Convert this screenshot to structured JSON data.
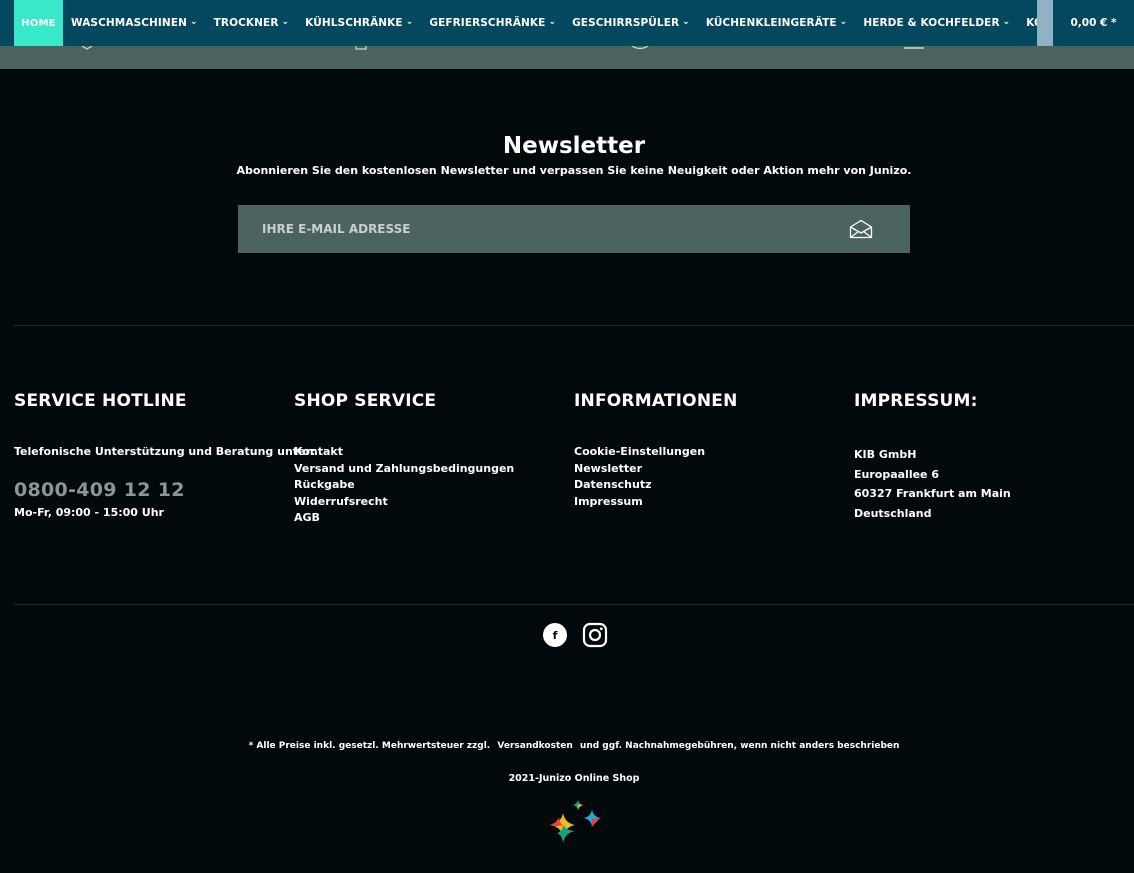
{
  "nav": {
    "home_label": "HOME",
    "items": [
      {
        "label": "WASCHMASCHINEN"
      },
      {
        "label": "TROCKNER"
      },
      {
        "label": "KÜHLSCHRÄNKE"
      },
      {
        "label": "GEFRIERSCHRÄNKE"
      },
      {
        "label": "GESCHIRRSPÜLER"
      },
      {
        "label": "KÜCHENKLEINGERÄTE"
      },
      {
        "label": "HERDE & KOCHFELDER"
      },
      {
        "label": "KOCH- & BACKZ"
      }
    ],
    "cart_total": "0,00 € *",
    "chevron_icon": "chevron-down-icon"
  },
  "newsletter": {
    "title": "Newsletter",
    "subtitle": "Abonnieren Sie den kostenlosen Newsletter und verpassen Sie keine Neuigkeit oder Aktion mehr von Junizo.",
    "email_placeholder": "IHRE E-MAIL ADRESSE",
    "submit_icon": "envelope-icon"
  },
  "footer": {
    "hotline": {
      "title": "SERVICE HOTLINE",
      "description": "Telefonische Unterstützung und Beratung unter:",
      "phone": "0800-409 12 12",
      "hours": "Mo-Fr, 09:00 - 15:00 Uhr"
    },
    "shop_service": {
      "title": "SHOP SERVICE",
      "links": [
        "Kontakt",
        "Versand und Zahlungsbedingungen",
        "Rückgabe",
        "Widerrufsrecht",
        "AGB"
      ]
    },
    "informationen": {
      "title": "INFORMATIONEN",
      "links": [
        "Cookie-Einstellungen",
        "Newsletter",
        "Datenschutz",
        "Impressum"
      ]
    },
    "impressum": {
      "title": "IMPRESSUM:",
      "lines": [
        "KIB GmbH",
        "Europaallee 6",
        "60327 Frankfurt am Main",
        "Deutschland"
      ]
    }
  },
  "social": {
    "facebook_glyph": "f",
    "icons": [
      "facebook-icon",
      "instagram-icon"
    ]
  },
  "legal": {
    "prefix": "* Alle Preise inkl. gesetzl. Mehrwertsteuer zzgl.",
    "shipping_link": "Versandkosten",
    "suffix": "und ggf. Nachnahmegebühren, wenn nicht anders beschrieben",
    "copyright": "2021-Junizo Online Shop"
  },
  "colors": {
    "nav_bg": "#03485f",
    "home_active": "#38e8c9",
    "strip_bg": "#4a6361",
    "page_bg": "#02090b",
    "phone_text": "#8e9597"
  }
}
